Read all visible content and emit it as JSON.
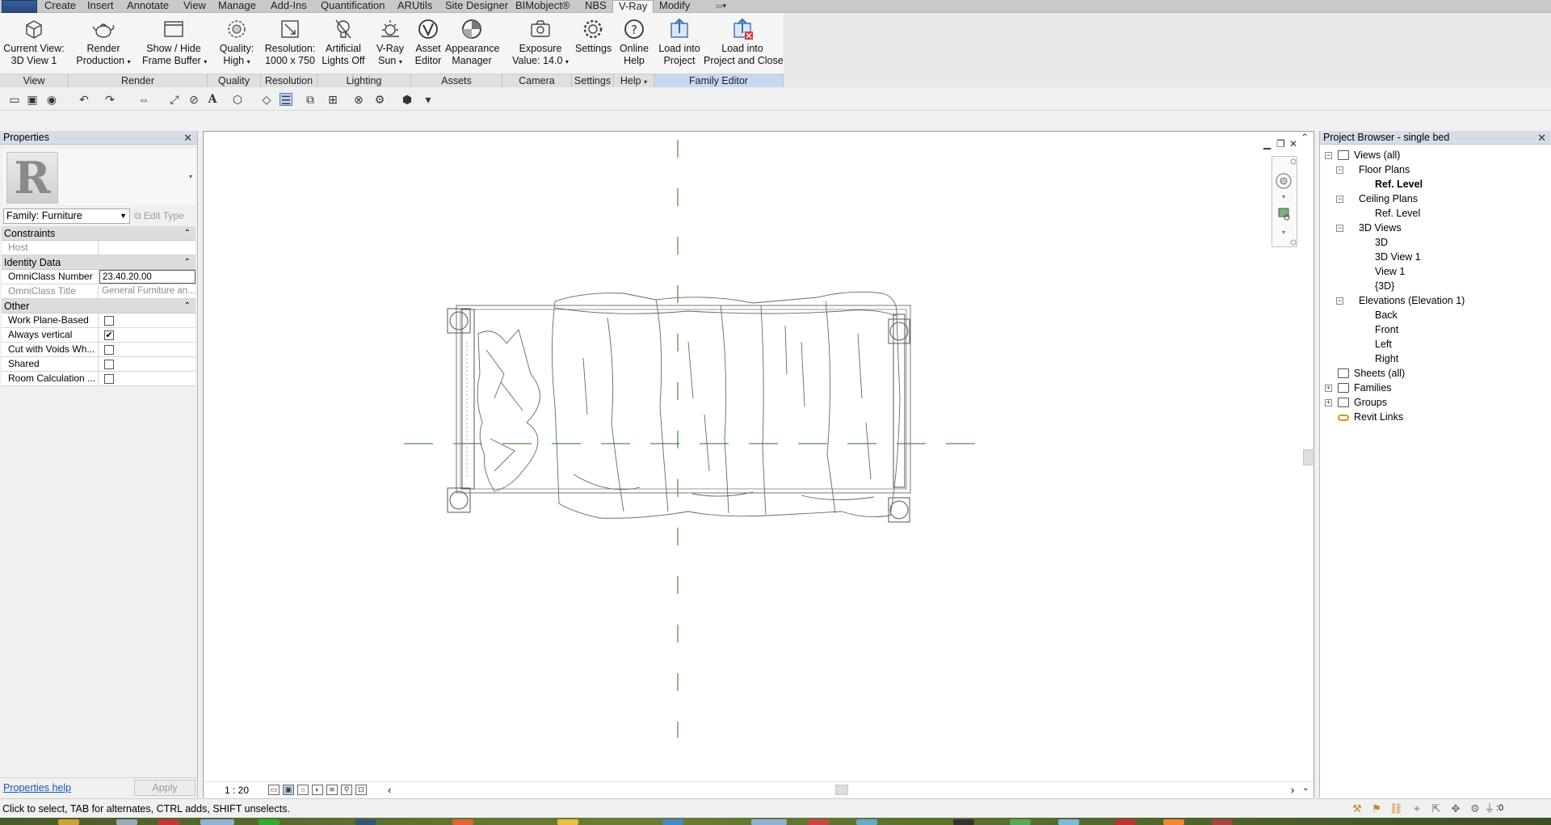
{
  "ribbon_tabs": [
    "Create",
    "Insert",
    "Annotate",
    "View",
    "Manage",
    "Add-Ins",
    "Quantification",
    "ARUtils",
    "Site Designer",
    "BIMobject®",
    "NBS",
    "V-Ray",
    "Modify"
  ],
  "active_tab": "V-Ray",
  "ribbon": {
    "buttons": [
      {
        "l1": "Current View:",
        "l2": "3D View 1",
        "icon": "3d-view-icon"
      },
      {
        "l1": "Render",
        "l2": "Production",
        "icon": "teapot-render-icon",
        "dropdown": true
      },
      {
        "l1": "Show / Hide",
        "l2": "Frame Buffer",
        "icon": "frame-buffer-icon",
        "dropdown": true
      },
      {
        "l1": "Quality:",
        "l2": "High",
        "icon": "quality-icon",
        "dropdown": true
      },
      {
        "l1": "Resolution:",
        "l2": "1000 x 750",
        "icon": "resolution-icon"
      },
      {
        "l1": "Artificial",
        "l2": "Lights Off",
        "icon": "light-bulb-icon"
      },
      {
        "l1": "V-Ray",
        "l2": "Sun",
        "icon": "sun-icon",
        "dropdown": true
      },
      {
        "l1": "Asset",
        "l2": "Editor",
        "icon": "vray-logo-icon"
      },
      {
        "l1": "Appearance",
        "l2": "Manager",
        "icon": "appearance-icon"
      },
      {
        "l1": "Exposure",
        "l2": "Value: 14.0",
        "icon": "camera-icon",
        "dropdown": true
      },
      {
        "l1": "Settings",
        "l2": "",
        "icon": "gear-icon"
      },
      {
        "l1": "Online",
        "l2": "Help",
        "icon": "help-icon"
      },
      {
        "l1": "Load into",
        "l2": "Project",
        "icon": "load-into-project-icon"
      },
      {
        "l1": "Load into",
        "l2": "Project and Close",
        "icon": "load-and-close-icon"
      }
    ],
    "panels": [
      "View",
      "Render",
      "Quality",
      "Resolution",
      "Lighting",
      "Assets",
      "Camera",
      "Settings",
      "Help",
      "Family Editor"
    ]
  },
  "properties": {
    "title": "Properties",
    "family_selector": "Family: Furniture",
    "edit_type": "Edit Type",
    "sections": [
      {
        "name": "Constraints",
        "rows": [
          {
            "key": "Host",
            "value": "",
            "grey": true
          }
        ]
      },
      {
        "name": "Identity Data",
        "rows": [
          {
            "key": "OmniClass Number",
            "value": "23.40.20.00",
            "editing": true
          },
          {
            "key": "OmniClass Title",
            "value": "General Furniture an...",
            "grey": true
          }
        ]
      },
      {
        "name": "Other",
        "rows": [
          {
            "key": "Work Plane-Based",
            "checkbox": false
          },
          {
            "key": "Always vertical",
            "checkbox": true
          },
          {
            "key": "Cut with Voids Wh...",
            "checkbox": false
          },
          {
            "key": "Shared",
            "checkbox": false
          },
          {
            "key": "Room Calculation ...",
            "checkbox": false
          }
        ]
      }
    ],
    "help_link": "Properties help",
    "apply": "Apply"
  },
  "view": {
    "scale": "1 : 20"
  },
  "browser": {
    "title": "Project Browser - single bed",
    "tree": [
      {
        "label": "Views (all)",
        "level": 0,
        "box": "−",
        "icon": true
      },
      {
        "label": "Floor Plans",
        "level": 1,
        "box": "−"
      },
      {
        "label": "Ref. Level",
        "level": 2,
        "bold": true
      },
      {
        "label": "Ceiling Plans",
        "level": 1,
        "box": "−"
      },
      {
        "label": "Ref. Level",
        "level": 2
      },
      {
        "label": "3D Views",
        "level": 1,
        "box": "−"
      },
      {
        "label": "3D",
        "level": 2
      },
      {
        "label": "3D View 1",
        "level": 2
      },
      {
        "label": "View 1",
        "level": 2
      },
      {
        "label": "{3D}",
        "level": 2
      },
      {
        "label": "Elevations (Elevation 1)",
        "level": 1,
        "box": "−"
      },
      {
        "label": "Back",
        "level": 2
      },
      {
        "label": "Front",
        "level": 2
      },
      {
        "label": "Left",
        "level": 2
      },
      {
        "label": "Right",
        "level": 2
      },
      {
        "label": "Sheets (all)",
        "level": 0,
        "icon": true
      },
      {
        "label": "Families",
        "level": 0,
        "box": "+",
        "icon": true
      },
      {
        "label": "Groups",
        "level": 0,
        "box": "+",
        "icon": true
      },
      {
        "label": "Revit Links",
        "level": 0,
        "icon": true
      }
    ]
  },
  "status": {
    "text": "Click to select, TAB for alternates, CTRL adds, SHIFT unselects.",
    "filter_count": ":0"
  }
}
